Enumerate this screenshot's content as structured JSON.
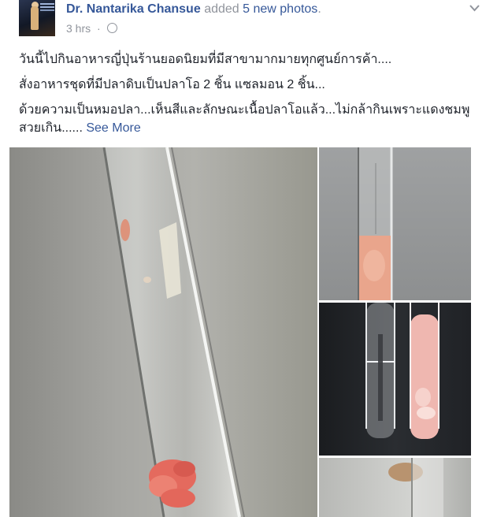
{
  "post": {
    "author": "Dr. Nantarika Chansue",
    "action_prefix": "added ",
    "action_highlight": "5 new photos",
    "action_suffix": ".",
    "timestamp": "3 hrs",
    "separator": "·",
    "icons": {
      "menu": "chevron-down-icon",
      "audience": "globe-icon"
    },
    "lines": [
      "วันนี้ไปกินอาหารญี่ปุ่นร้านยอดนิยมที่มีสาขามากมายทุกศูนย์การค้า....",
      "สั่งอาหารชุดที่มีปลาดิบเป็นปลาโอ 2 ชิ้น แซลมอน 2 ชิ้น...",
      "ด้วยความเป็นหมอปลา...เห็นสีและลักษณะเนื้อปลาโอแล้ว...ไม่กล้ากินเพราะแดงชมพูสวยเกิน......"
    ],
    "see_more": "See More"
  },
  "colors": {
    "link": "#365899",
    "muted": "#90949c",
    "text": "#1d2129",
    "background": "#ffffff"
  }
}
